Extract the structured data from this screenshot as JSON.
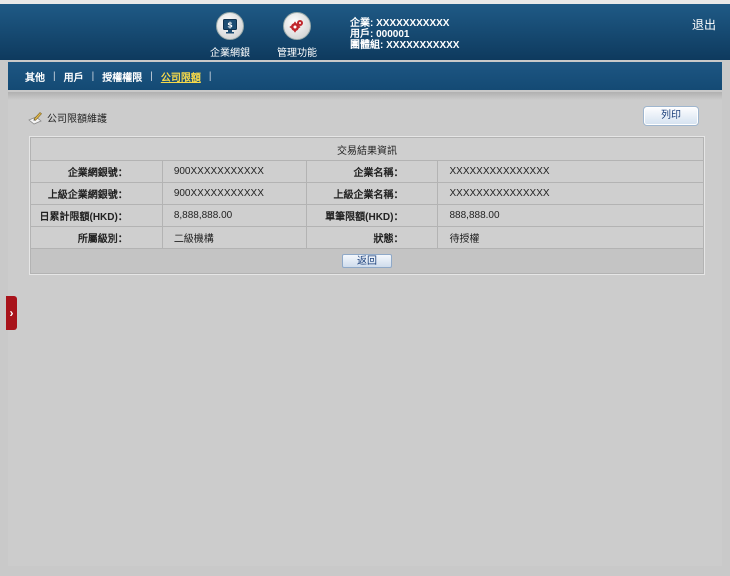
{
  "header": {
    "nav": [
      {
        "label": "企業網銀",
        "icon": "monitor-dollar-icon"
      },
      {
        "label": "管理功能",
        "icon": "gears-icon"
      }
    ],
    "user": {
      "company": "企業: XXXXXXXXXXX",
      "user_id": "用戶: 000001",
      "group": "團體組: XXXXXXXXXXX"
    },
    "logout_label": "退出"
  },
  "subnav": {
    "items": [
      {
        "label": "其他"
      },
      {
        "label": "用戶"
      },
      {
        "label": "授權權限"
      },
      {
        "label": "公司限額",
        "active": true
      }
    ],
    "sep": "|"
  },
  "page": {
    "title": "公司限額維護",
    "title_icon": "pencil-paper-icon",
    "print_label": "列印"
  },
  "result": {
    "header": "交易結果資訊",
    "rows": [
      {
        "l1": "企業網銀號：",
        "v1": "900XXXXXXXXXXX",
        "l2": "企業名稱：",
        "v2": "XXXXXXXXXXXXXXX"
      },
      {
        "l1": "上級企業網銀號：",
        "v1": "900XXXXXXXXXXX",
        "l2": "上級企業名稱：",
        "v2": "XXXXXXXXXXXXXXX"
      },
      {
        "l1": "日累計限額(HKD)：",
        "v1": "8,888,888.00",
        "l2": "單筆限額(HKD)：",
        "v2": "888,888.00"
      },
      {
        "l1": "所屬級別：",
        "v1": "二級機構",
        "l2": "狀態：",
        "v2": "待授權"
      }
    ],
    "back_label": "返回"
  },
  "sidebar": {
    "toggle_icon": "chevron-right-icon",
    "toggle_glyph": "›"
  }
}
